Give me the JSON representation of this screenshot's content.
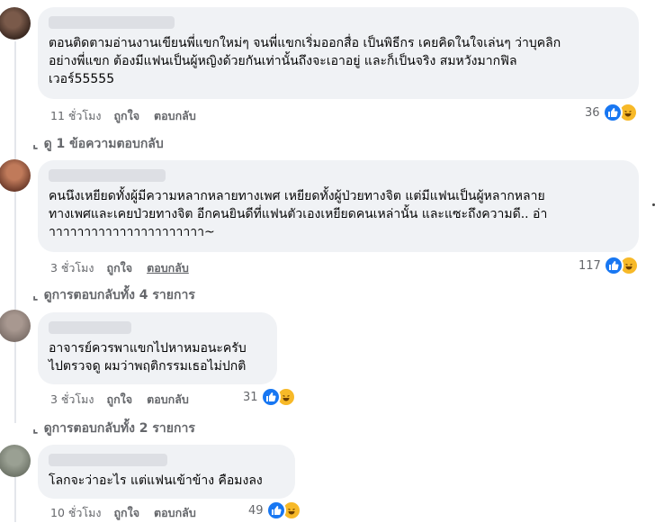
{
  "comments": [
    {
      "text": "ตอนติดตามอ่านงานเขียนพี่แขกใหม่ๆ จนพี่แขกเริ่มออกสื่อ เป็นพิธีกร เคยคิดในใจเล่นๆ ว่าบุคลิก\nอย่างพี่แขก ต้องมีแฟนเป็นผู้หญิงด้วยกันเท่านั้นถึงจะเอาอยู่ และก็เป็นจริง สมหวังมากฟิล\nเวอร์55555",
      "time": "11 ชั่วโมง",
      "like_label": "ถูกใจ",
      "reply_label": "ตอบกลับ",
      "reactions": "36"
    },
    {
      "text": "คนนึงเหยียดทั้งผู้มีความหลากหลายทางเพศ เหยียดทั้งผู้ป่วยทางจิต แต่มีแฟนเป็นผู้หลากหลาย\nทางเพศและเคยป่วยทางจิต อีกคนยินดีที่แฟนตัวเองเหยียดคนเหล่านั้น และแซะถึงความดี.. อ่า\nาาาาาาาาาาาาาาาาาาาาาา~",
      "time": "3 ชั่วโมง",
      "like_label": "ถูกใจ",
      "reply_label": "ตอบกลับ",
      "reactions": "117"
    },
    {
      "text": "อาจารย์ควรพาแขกไปหาหมอนะครับ\nไปตรวจดู ผมว่าพฤติกรรมเธอไม่ปกติ",
      "time": "3 ชั่วโมง",
      "like_label": "ถูกใจ",
      "reply_label": "ตอบกลับ",
      "reactions": "31"
    },
    {
      "text": "โลกจะว่าอะไร แต่แฟนเข้าข้าง คือมงลง",
      "time": "10 ชั่วโมง",
      "like_label": "ถูกใจ",
      "reply_label": "ตอบกลับ",
      "reactions": "49"
    }
  ],
  "view_replies": [
    "ดู 1 ข้อความตอบกลับ",
    "ดูการตอบกลับทั้ง 4 รายการ",
    "ดูการตอบกลับทั้ง 2 รายการ"
  ],
  "colors": {
    "bubble": "#f0f2f5",
    "meta_text": "#65676b",
    "like": "#1877f2",
    "haha": "#f7b928"
  }
}
